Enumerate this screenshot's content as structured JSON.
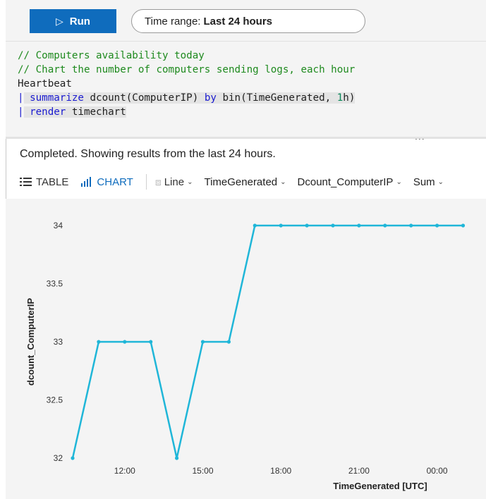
{
  "toolbar": {
    "run_label": "Run",
    "run_icon": "play-icon",
    "time_range_prefix": "Time range:",
    "time_range_value": "Last 24 hours"
  },
  "query": {
    "line1": "// Computers availability today",
    "line2": "// Chart the number of computers sending logs, each hour",
    "line3": "Heartbeat",
    "line4_kw": "summarize",
    "line4_rest1": " dcount(ComputerIP) ",
    "line4_by": "by",
    "line4_rest2": " bin(TimeGenerated, ",
    "line4_num": "1",
    "line4_end": "h)",
    "line5_kw": "render",
    "line5_rest": " timechart",
    "pipe": "|",
    "more": "..."
  },
  "results": {
    "status": "Completed. Showing results from the last 24 hours.",
    "tab_table": "TABLE",
    "tab_chart": "CHART",
    "chart_type": "Line",
    "x_column": "TimeGenerated",
    "y_column": "Dcount_ComputerIP",
    "aggregation": "Sum"
  },
  "chart_data": {
    "type": "line",
    "xlabel": "TimeGenerated [UTC]",
    "ylabel": "dcount_ComputerIP",
    "ylim": [
      32,
      34
    ],
    "y_ticks": [
      "32",
      "32.5",
      "33",
      "33.5",
      "34"
    ],
    "x_ticks": [
      "12:00",
      "15:00",
      "18:00",
      "21:00",
      "00:00"
    ],
    "series_color": "#1fb6d8",
    "x_hours": [
      10,
      11,
      12,
      13,
      14,
      15,
      16,
      17,
      18,
      19,
      20,
      21,
      22,
      23,
      24,
      25
    ],
    "values": [
      32,
      33,
      33,
      33,
      32,
      33,
      33,
      34,
      34,
      34,
      34,
      34,
      34,
      34,
      34,
      34
    ]
  }
}
